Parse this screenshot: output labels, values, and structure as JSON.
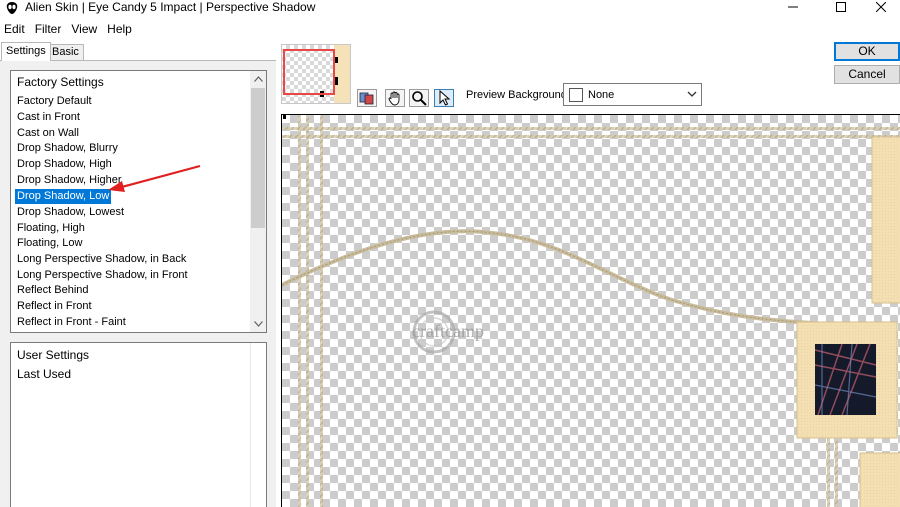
{
  "window": {
    "title": "Alien Skin | Eye Candy 5 Impact | Perspective Shadow",
    "app_icon": "alien-skin-icon",
    "controls": [
      "minimize-icon",
      "maximize-icon",
      "close-icon"
    ]
  },
  "menu": [
    "Edit",
    "Filter",
    "View",
    "Help"
  ],
  "tabs": [
    {
      "label": "Settings",
      "active": true
    },
    {
      "label": "Basic",
      "active": false
    }
  ],
  "factory_settings": {
    "header": "Factory Settings",
    "items": [
      "Factory Default",
      "Cast in Front",
      "Cast on Wall",
      "Drop Shadow, Blurry",
      "Drop Shadow, High",
      "Drop Shadow, Higher",
      "Drop Shadow, Low",
      "Drop Shadow, Lowest",
      "Floating, High",
      "Floating, Low",
      "Long Perspective Shadow, in Back",
      "Long Perspective Shadow, in Front",
      "Reflect Behind",
      "Reflect in Front",
      "Reflect in Front - Faint"
    ],
    "selected": "Drop Shadow, Low"
  },
  "user_settings": {
    "header": "User Settings",
    "items": [
      "Last Used"
    ]
  },
  "toolbar": {
    "tools": [
      "before-after-icon",
      "pan-hand-icon",
      "zoom-icon",
      "pointer-icon"
    ],
    "preview_background_label": "Preview Background:",
    "preview_background_value": "None"
  },
  "buttons": {
    "ok": "OK",
    "cancel": "Cancel"
  },
  "watermark": "craftcamp",
  "colors": {
    "selection": "#0078d7",
    "annotation_arrow": "#e02020",
    "frame_beige": "#f3dfb2"
  }
}
